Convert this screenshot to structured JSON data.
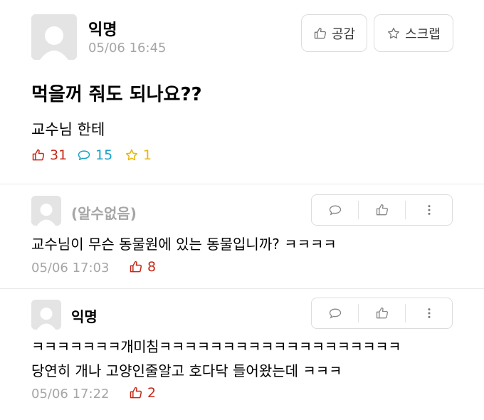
{
  "post": {
    "author": "익명",
    "time": "05/06 16:45",
    "title": "먹을꺼 줘도 되나요??",
    "body": "교수님 한테",
    "buttons": {
      "like": "공감",
      "scrap": "스크랩"
    },
    "stats": {
      "likes": "31",
      "comments": "15",
      "scraps": "1"
    }
  },
  "comments": [
    {
      "author": "(알수없음)",
      "text": "교수님이 무슨 동물원에 있는 동물입니까? ㅋㅋㅋㅋ",
      "time": "05/06 17:03",
      "likes": "8"
    },
    {
      "author": "익명",
      "text_line1": "ㅋㅋㅋㅋㅋㅋㅋ개미침ㅋㅋㅋㅋㅋㅋㅋㅋㅋㅋㅋㅋㅋㅋㅋㅋㅋㅋㅋ",
      "text_line2": "당연히 개나 고양인줄알고 호다닥 들어왔는데 ㅋㅋㅋ",
      "time": "05/06 17:22",
      "likes": "2"
    }
  ],
  "colors": {
    "like": "#c62917",
    "comment": "#14a3c7",
    "scrap": "#e7b60b"
  }
}
